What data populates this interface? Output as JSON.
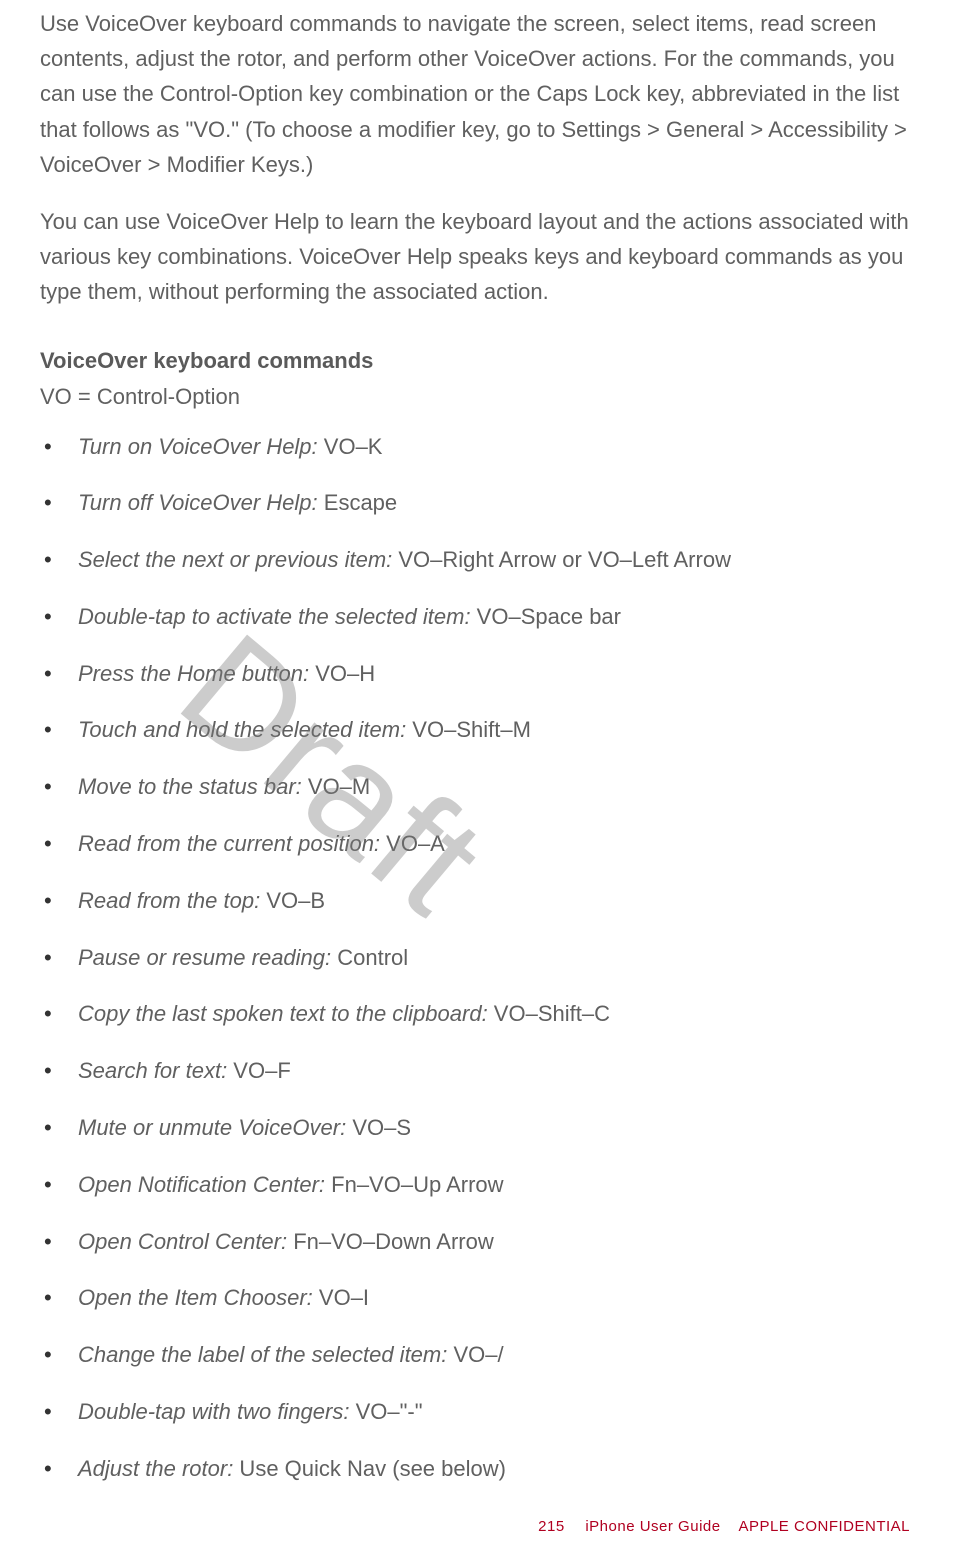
{
  "intro_p1": "Use VoiceOver keyboard commands to navigate the screen, select items, read screen contents, adjust the rotor, and perform other VoiceOver actions. For the commands, you can use the Control-Option key combination or the Caps Lock key, abbreviated in the list that follows as \"VO.\" (To choose a modifier key, go to Settings > General > Accessibility > VoiceOver > Modifier Keys.)",
  "intro_p2": "You can use VoiceOver Help to learn the keyboard layout and the actions associated with various key combinations. VoiceOver Help speaks keys and keyboard commands as you type them, without performing the associated action.",
  "section_heading": "VoiceOver keyboard commands",
  "vo_definition": "VO = Control-Option",
  "commands": [
    {
      "label": "Turn on VoiceOver Help:",
      "keys": " VO–K"
    },
    {
      "label": "Turn off VoiceOver Help:",
      "keys": " Escape"
    },
    {
      "label": "Select the next or previous item:",
      "keys": " VO–Right Arrow or VO–Left Arrow"
    },
    {
      "label": "Double-tap to activate the selected item:",
      "keys": " VO–Space bar"
    },
    {
      "label": "Press the Home button:",
      "keys": " VO–H"
    },
    {
      "label": "Touch and hold the selected item:",
      "keys": " VO–Shift–M"
    },
    {
      "label": "Move to the status bar:",
      "keys": " VO–M"
    },
    {
      "label": "Read from the current position:",
      "keys": " VO–A"
    },
    {
      "label": "Read from the top:",
      "keys": " VO–B"
    },
    {
      "label": "Pause or resume reading:",
      "keys": " Control"
    },
    {
      "label": "Copy the last spoken text to the clipboard:",
      "keys": " VO–Shift–C"
    },
    {
      "label": "Search for text:",
      "keys": " VO–F"
    },
    {
      "label": "Mute or unmute VoiceOver:",
      "keys": " VO–S"
    },
    {
      "label": "Open Notification Center:",
      "keys": " Fn–VO–Up Arrow"
    },
    {
      "label": "Open Control Center:",
      "keys": " Fn–VO–Down Arrow"
    },
    {
      "label": "Open the Item Chooser:",
      "keys": " VO–I"
    },
    {
      "label": "Change the label of the selected item:",
      "keys": " VO–/"
    },
    {
      "label": "Double-tap with two fingers:",
      "keys": " VO–\"-\""
    },
    {
      "label": "Adjust the rotor:",
      "keys": " Use Quick Nav (see below)"
    }
  ],
  "watermark": "Draft",
  "footer": {
    "page_number": "215",
    "title": "iPhone User Guide",
    "confidential": "APPLE CONFIDENTIAL"
  }
}
